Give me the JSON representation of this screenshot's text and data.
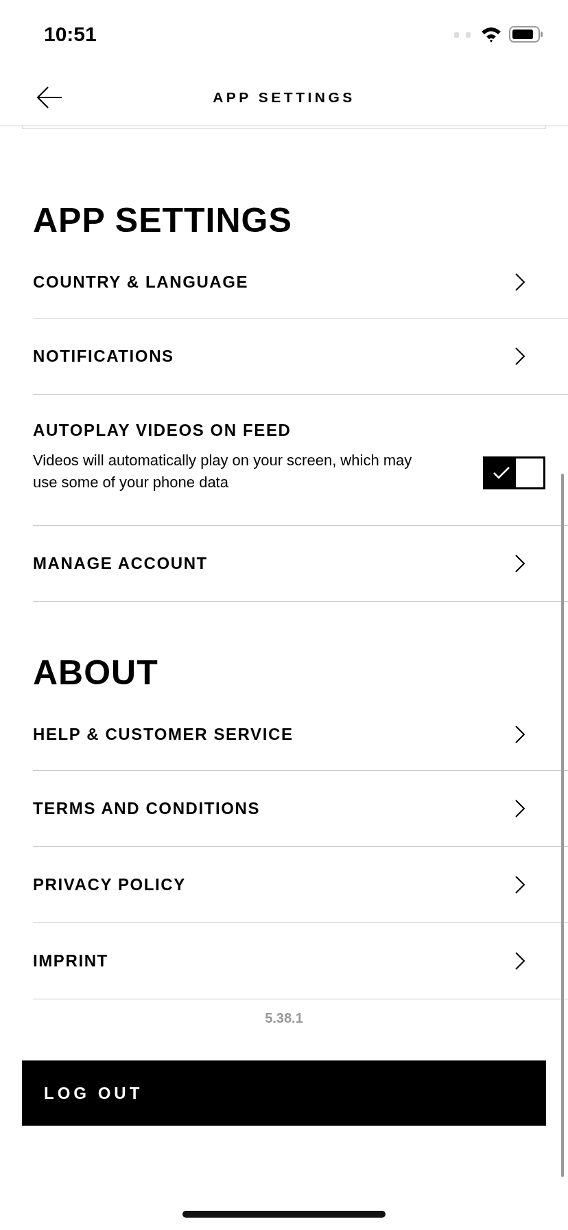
{
  "status_bar": {
    "time": "10:51"
  },
  "header": {
    "title": "APP SETTINGS"
  },
  "sections": [
    {
      "title": "APP SETTINGS",
      "items": [
        {
          "kind": "link",
          "label": "COUNTRY & LANGUAGE"
        },
        {
          "kind": "link",
          "label": "NOTIFICATIONS"
        },
        {
          "kind": "toggle",
          "label": "AUTOPLAY VIDEOS ON FEED",
          "description": "Videos will automatically play on your screen, which may use some of your phone data",
          "on": true
        },
        {
          "kind": "link",
          "label": "MANAGE ACCOUNT"
        }
      ]
    },
    {
      "title": "ABOUT",
      "items": [
        {
          "kind": "link",
          "label": "HELP & CUSTOMER SERVICE"
        },
        {
          "kind": "link",
          "label": "TERMS AND CONDITIONS"
        },
        {
          "kind": "link",
          "label": "PRIVACY POLICY"
        },
        {
          "kind": "link",
          "label": "IMPRINT"
        }
      ]
    }
  ],
  "version": "5.38.1",
  "logout": {
    "label": "LOG OUT"
  }
}
